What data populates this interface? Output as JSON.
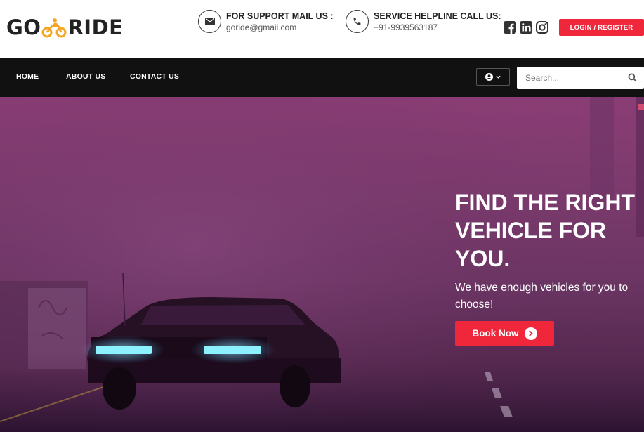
{
  "brand": {
    "part1": "GO",
    "part2": "RIDE",
    "accent_color": "#f5a623"
  },
  "support": {
    "title": "FOR SUPPORT MAIL US :",
    "value": "goride@gmail.com",
    "icon": "envelope-icon"
  },
  "helpline": {
    "title": "SERVICE HELPLINE CALL US:",
    "value": "+91-9939563187",
    "icon": "phone-icon"
  },
  "socials": [
    "facebook-icon",
    "linkedin-icon",
    "instagram-icon"
  ],
  "login_label": "LOGIN / REGISTER",
  "nav": {
    "items": [
      {
        "label": "HOME"
      },
      {
        "label": "ABOUT US"
      },
      {
        "label": "CONTACT US"
      }
    ]
  },
  "search": {
    "placeholder": "Search..."
  },
  "hero": {
    "title": "FIND THE RIGHT VEHICLE FOR YOU.",
    "subtitle": "We have enough vehicles for you to choose!",
    "button_label": "Book Now"
  },
  "colors": {
    "primary": "#f0263a",
    "nav_bg": "#111111",
    "hero_tint": "#7a3a6c"
  }
}
